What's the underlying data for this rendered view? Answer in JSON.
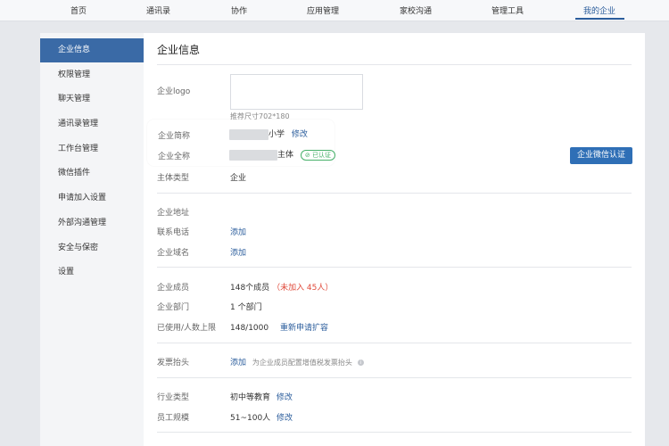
{
  "nav": {
    "tabs": [
      "首页",
      "通讯录",
      "协作",
      "应用管理",
      "家校沟通",
      "管理工具",
      "我的企业"
    ],
    "active": "我的企业"
  },
  "sidebar": {
    "items": [
      "企业信息",
      "权限管理",
      "聊天管理",
      "通讯录管理",
      "工作台管理",
      "微信插件",
      "申请加入设置",
      "外部沟通管理",
      "安全与保密",
      "设置"
    ],
    "active": "企业信息"
  },
  "main": {
    "title": "企业信息",
    "logo_label": "企业logo",
    "logo_hint": "推荐尺寸702*180",
    "short_name_label": "企业简称",
    "short_name_suffix": "小学",
    "edit_label": "修改",
    "full_name_label": "企业全称",
    "full_name_suffix": "主体",
    "verified_badge": "已认证",
    "verify_button": "企业微信认证",
    "entity_type_label": "主体类型",
    "entity_type_value": "企业",
    "address_label": "企业地址",
    "phone_label": "联系电话",
    "phone_action": "添加",
    "domain_label": "企业域名",
    "domain_action": "添加",
    "members_label": "企业成员",
    "members_value": "148个成员",
    "members_not_joined": "（未加入 45人）",
    "departments_label": "企业部门",
    "departments_value": "1 个部门",
    "limit_label": "已使用/人数上限",
    "limit_value": "148/1000",
    "limit_action": "重新申请扩容",
    "invoice_label": "发票抬头",
    "invoice_action": "添加",
    "invoice_hint": "为企业成员配置增值税发票抬头",
    "industry_label": "行业类型",
    "industry_value": "初中等教育",
    "industry_edit": "修改",
    "size_label": "员工规模",
    "size_value": "51~100人",
    "size_edit": "修改"
  },
  "colors": {
    "accent": "#2b5d9c",
    "sidebar_active": "#3a6aa6",
    "button": "#2f6fb6",
    "verified": "#47b06a",
    "warning": "#e04b3c"
  }
}
